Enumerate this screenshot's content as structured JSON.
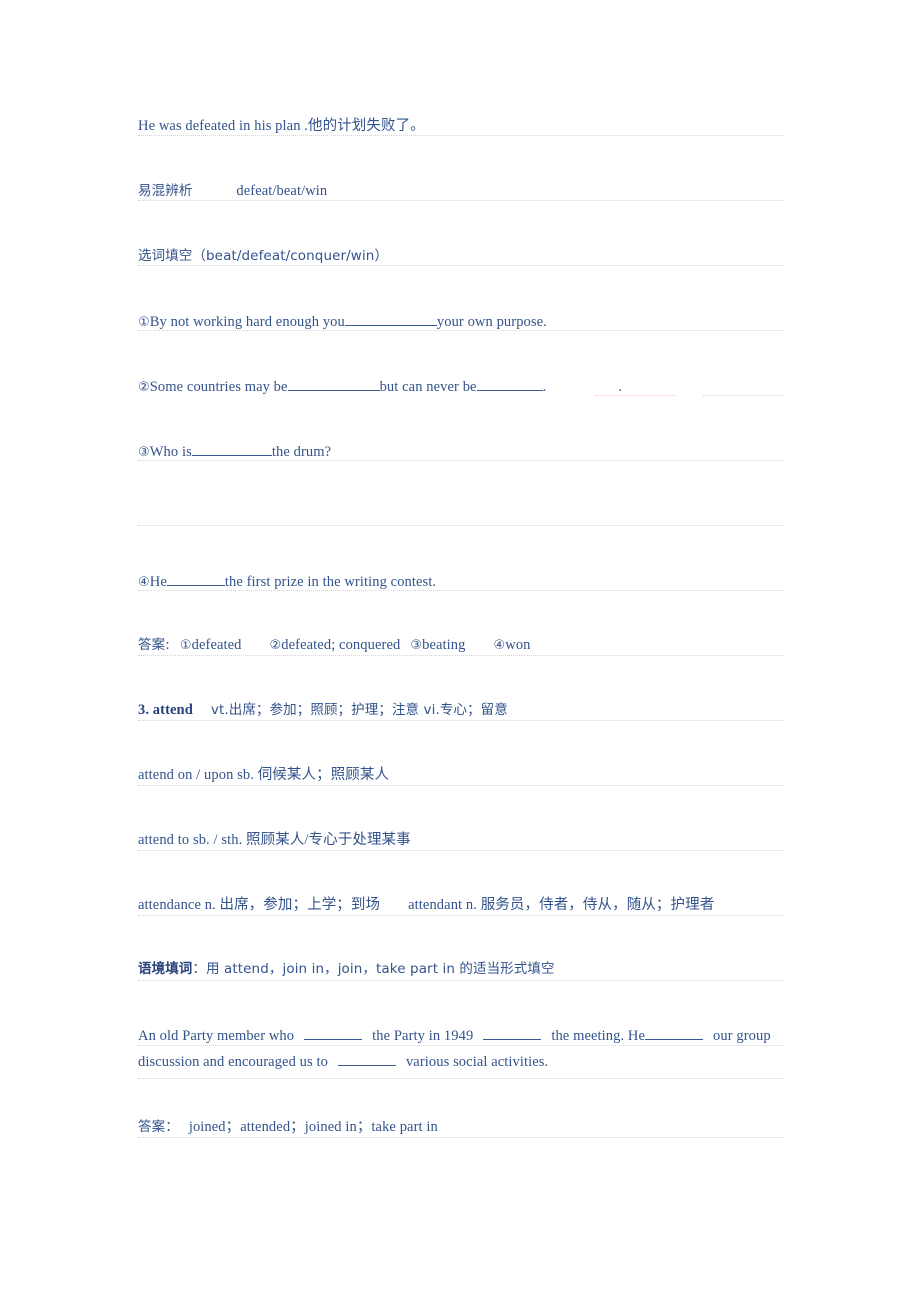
{
  "page": {
    "text_color": "#33538c",
    "bold_color": "#27427a",
    "rule_color_gray": "#d5d5d9",
    "rule_color_pink": "#e8c9d4",
    "blank_color": "#3a5a96"
  },
  "content": {
    "example_sentence": "He was defeated in his plan .他的计划失败了。",
    "confusable_label": "易混辨析",
    "confusable_words": "defeat/beat/win",
    "cloze_heading": "选词填空（beat/defeat/conquer/win）",
    "items": [
      {
        "marker": "①",
        "before": "By not working hard enough you",
        "after": "your own purpose."
      },
      {
        "marker": "②",
        "before": "Some countries may be",
        "middle": "but can never be",
        "after": ".",
        "trailing_dot": "."
      },
      {
        "marker": "③",
        "before": "Who is",
        "after": "the drum?"
      },
      {
        "marker": "④",
        "before": "He",
        "after": "the first prize in the writing contest."
      }
    ],
    "answer_label_1": "答案:",
    "answers_1": [
      {
        "marker": "①",
        "text": "defeated"
      },
      {
        "marker": "②",
        "text": "defeated; conquered"
      },
      {
        "marker": "③",
        "text": "beating"
      },
      {
        "marker": "④",
        "text": "won"
      }
    ],
    "entry_number": "3. attend",
    "entry_definition": "vt.出席；参加；照顾；护理；注意 vi.专心；留意",
    "phrase_1": "attend on / upon sb.  伺候某人；照顾某人",
    "phrase_2": "attend to sb. / sth.  照顾某人/专心于处理某事",
    "derivative_1": "attendance n.  出席，参加；上学；到场",
    "derivative_2": "attendant n.  服务员，侍者，侍从，随从；护理者",
    "context_label": "语境填词",
    "context_instruction": "：用 attend，join in，join，take part in 的适当形式填空",
    "passage_part_1": "An old Party member who",
    "passage_part_2": "the Party in 1949",
    "passage_part_3": "the meeting. He",
    "passage_part_4": "our group discussion and encouraged us to",
    "passage_part_5": "various social activities.",
    "answer_label_2": "答案：",
    "answers_2": "joined；attended；joined in；take part in"
  }
}
